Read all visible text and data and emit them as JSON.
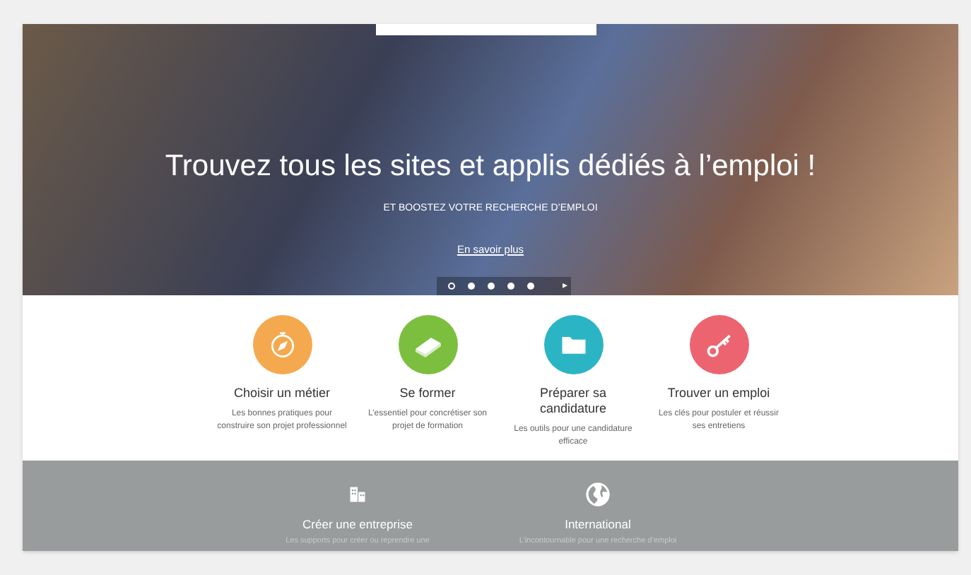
{
  "hero": {
    "title": "Trouvez tous les sites et applis dédiés à l’emploi !",
    "subtitle": "ET BOOSTEZ VOTRE RECHERCHE D’EMPLOI",
    "link": "En savoir plus",
    "slides": [
      {
        "selected": true
      },
      {
        "selected": false
      },
      {
        "selected": false
      },
      {
        "selected": false
      },
      {
        "selected": false
      }
    ],
    "next": "▸"
  },
  "features": [
    {
      "kind": "compass",
      "color": "#f5a94e",
      "title": "Choisir un métier",
      "text": "Les bonnes pratiques pour construire son projet professionnel"
    },
    {
      "kind": "book",
      "color": "#7cbf3f",
      "title": "Se former",
      "text": "L’essentiel pour concrétiser son projet de formation"
    },
    {
      "kind": "folder",
      "color": "#2bb5c4",
      "title": "Préparer sa candidature",
      "text": "Les outils pour une candidature efficace"
    },
    {
      "kind": "key",
      "color": "#ec6470",
      "title": "Trouver un emploi",
      "text": "Les clés pour postuler et réussir ses entretiens"
    }
  ],
  "band": [
    {
      "kind": "building",
      "title": "Créer une entreprise",
      "text": "Les supports pour créer ou reprendre une"
    },
    {
      "kind": "globe",
      "title": "International",
      "text": "L’incontournable pour une recherche d’emploi"
    }
  ]
}
